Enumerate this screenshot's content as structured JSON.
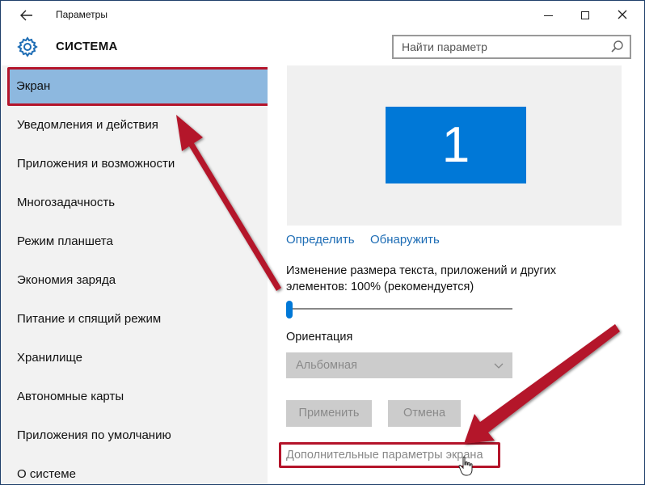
{
  "window": {
    "title": "Параметры",
    "back_icon": "back-arrow-icon",
    "controls": {
      "minimize": "minimize-icon",
      "maximize": "maximize-icon",
      "close": "close-icon"
    }
  },
  "header": {
    "section_title": "СИСТЕМА",
    "section_icon": "gear-icon",
    "search_placeholder": "Найти параметр",
    "search_icon": "search-icon"
  },
  "sidebar": {
    "active_index": 0,
    "items": [
      {
        "label": "Экран"
      },
      {
        "label": "Уведомления и действия"
      },
      {
        "label": "Приложения и возможности"
      },
      {
        "label": "Многозадачность"
      },
      {
        "label": "Режим планшета"
      },
      {
        "label": "Экономия заряда"
      },
      {
        "label": "Питание и спящий режим"
      },
      {
        "label": "Хранилище"
      },
      {
        "label": "Автономные карты"
      },
      {
        "label": "Приложения по умолчанию"
      },
      {
        "label": "О системе"
      }
    ]
  },
  "display": {
    "monitor_number": "1",
    "identify_link": "Определить",
    "detect_link": "Обнаружить",
    "scale_label": "Изменение размера текста, приложений и других элементов: 100% (рекомендуется)",
    "scale_slider_value": 0,
    "orientation_label": "Ориентация",
    "orientation_value": "Альбомная",
    "apply_button": "Применить",
    "cancel_button": "Отмена",
    "advanced_link": "Дополнительные параметры экрана"
  },
  "colors": {
    "accent": "#0078d7",
    "highlight_red": "#b4142a",
    "selected_bg": "#8db8df",
    "link": "#1e6db5"
  }
}
